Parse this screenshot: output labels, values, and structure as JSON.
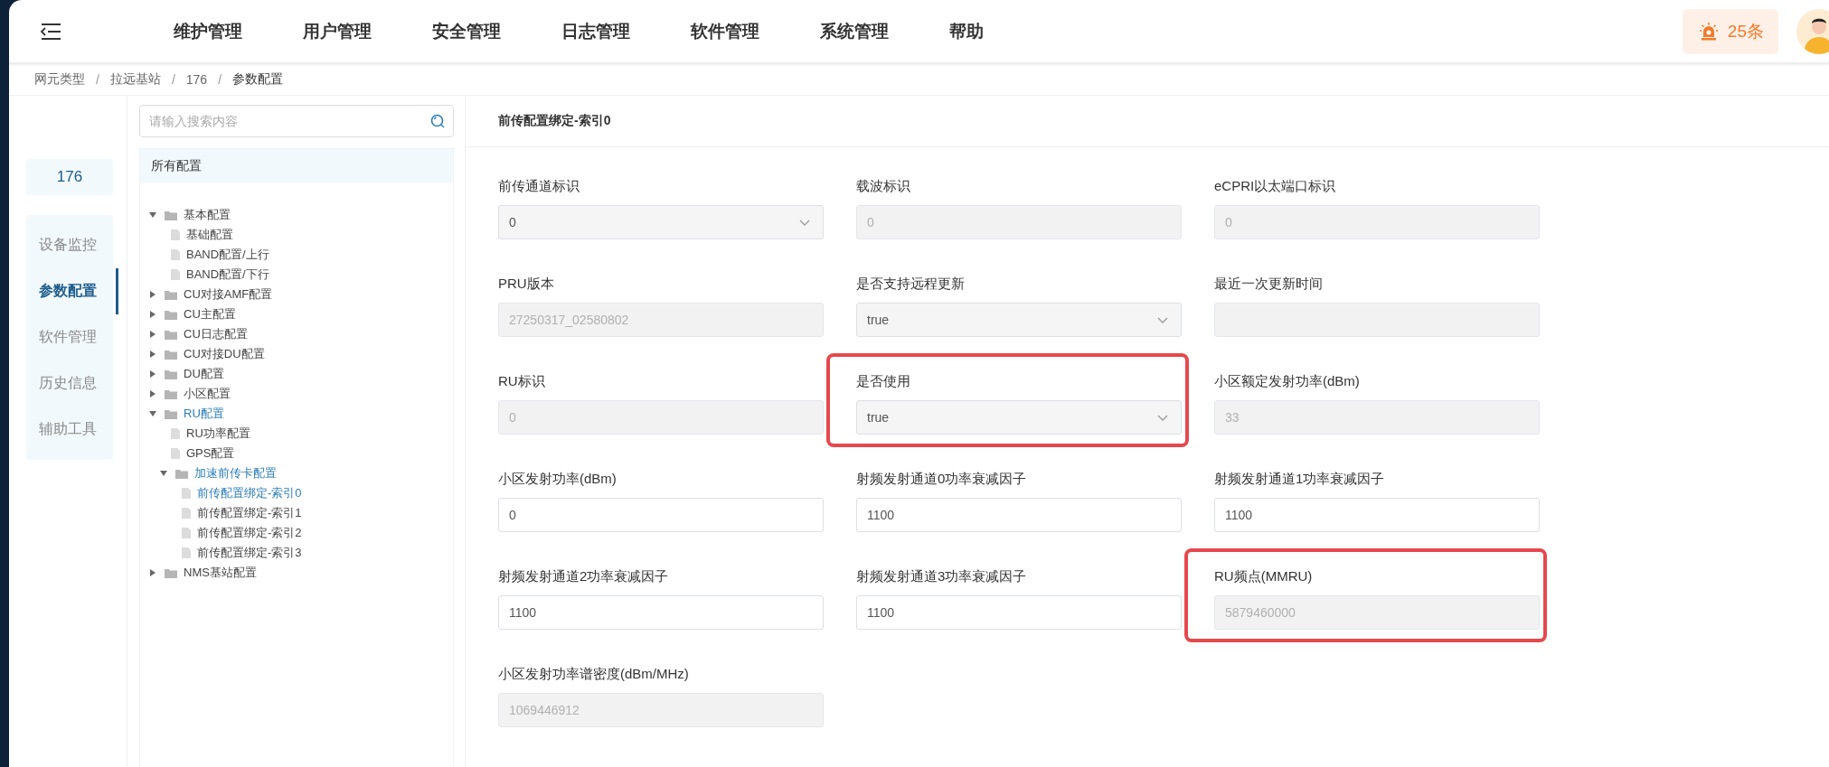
{
  "header": {
    "menu": [
      {
        "label": "维护管理"
      },
      {
        "label": "用户管理"
      },
      {
        "label": "安全管理"
      },
      {
        "label": "日志管理"
      },
      {
        "label": "软件管理"
      },
      {
        "label": "系统管理"
      },
      {
        "label": "帮助"
      }
    ],
    "alarm_count": "25条"
  },
  "breadcrumb": {
    "separator": "/",
    "items": [
      "网元类型",
      "拉远基站",
      "176",
      "参数配置"
    ]
  },
  "device": "176",
  "nav": [
    {
      "label": "设备监控",
      "selected": false
    },
    {
      "label": "参数配置",
      "selected": true
    },
    {
      "label": "软件管理",
      "selected": false
    },
    {
      "label": "历史信息",
      "selected": false
    },
    {
      "label": "辅助工具",
      "selected": false
    }
  ],
  "search": {
    "placeholder": "请输入搜索内容"
  },
  "tree": {
    "title": "所有配置",
    "items": [
      {
        "kind": "folder",
        "label": "基本配置",
        "expanded": true,
        "selected": false,
        "children": [
          {
            "kind": "file",
            "label": "基础配置",
            "selected": false
          },
          {
            "kind": "file",
            "label": "BAND配置/上行",
            "selected": false
          },
          {
            "kind": "file",
            "label": "BAND配置/下行",
            "selected": false
          }
        ]
      },
      {
        "kind": "folder",
        "label": "CU对接AMF配置",
        "expanded": false,
        "selected": false
      },
      {
        "kind": "folder",
        "label": "CU主配置",
        "expanded": false,
        "selected": false
      },
      {
        "kind": "folder",
        "label": "CU日志配置",
        "expanded": false,
        "selected": false
      },
      {
        "kind": "folder",
        "label": "CU对接DU配置",
        "expanded": false,
        "selected": false
      },
      {
        "kind": "folder",
        "label": "DU配置",
        "expanded": false,
        "selected": false
      },
      {
        "kind": "folder",
        "label": "小区配置",
        "expanded": false,
        "selected": false
      },
      {
        "kind": "folder",
        "label": "RU配置",
        "expanded": true,
        "selected": true,
        "children": [
          {
            "kind": "file",
            "label": "RU功率配置",
            "selected": false
          },
          {
            "kind": "file",
            "label": "GPS配置",
            "selected": false
          },
          {
            "kind": "folder",
            "label": "加速前传卡配置",
            "expanded": true,
            "selected": true,
            "children": [
              {
                "kind": "file",
                "label": "前传配置绑定-索引0",
                "selected": true
              },
              {
                "kind": "file",
                "label": "前传配置绑定-索引1",
                "selected": false
              },
              {
                "kind": "file",
                "label": "前传配置绑定-索引2",
                "selected": false
              },
              {
                "kind": "file",
                "label": "前传配置绑定-索引3",
                "selected": false
              }
            ]
          }
        ]
      },
      {
        "kind": "folder",
        "label": "NMS基站配置",
        "expanded": false,
        "selected": false
      }
    ]
  },
  "form": {
    "title": "前传配置绑定-索引0",
    "fields": [
      {
        "label": "前传通道标识",
        "kind": "select",
        "value": "0",
        "disabled": false,
        "highlighted": false
      },
      {
        "label": "载波标识",
        "kind": "input",
        "value": "0",
        "disabled": true,
        "highlighted": false
      },
      {
        "label": "eCPRI以太端口标识",
        "kind": "input",
        "value": "0",
        "disabled": true,
        "highlighted": false
      },
      {
        "label": "PRU版本",
        "kind": "input",
        "value": "27250317_02580802",
        "disabled": true,
        "highlighted": false
      },
      {
        "label": "是否支持远程更新",
        "kind": "select",
        "value": "true",
        "disabled": false,
        "highlighted": false
      },
      {
        "label": "最近一次更新时间",
        "kind": "input",
        "disabled": true,
        "highlighted": false
      },
      {
        "label": "RU标识",
        "kind": "input",
        "value": "0",
        "disabled": true,
        "highlighted": false
      },
      {
        "label": "是否使用",
        "kind": "select",
        "value": "true",
        "disabled": false,
        "highlighted": true
      },
      {
        "label": "小区额定发射功率(dBm)",
        "kind": "input",
        "value": "33",
        "disabled": true,
        "highlighted": false
      },
      {
        "label": "小区发射功率(dBm)",
        "kind": "input",
        "value": "0",
        "disabled": false,
        "highlighted": false
      },
      {
        "label": "射频发射通道0功率衰减因子",
        "kind": "input",
        "value": "1100",
        "disabled": false,
        "highlighted": false
      },
      {
        "label": "射频发射通道1功率衰减因子",
        "kind": "input",
        "value": "1100",
        "disabled": false,
        "highlighted": false
      },
      {
        "label": "射频发射通道2功率衰减因子",
        "kind": "input",
        "value": "1100",
        "disabled": false,
        "highlighted": false
      },
      {
        "label": "射频发射通道3功率衰减因子",
        "kind": "input",
        "value": "1100",
        "disabled": false,
        "highlighted": false
      },
      {
        "label": "RU频点(MMRU)",
        "kind": "input",
        "value": "5879460000",
        "disabled": true,
        "highlighted": true
      },
      {
        "label": "小区发射功率谱密度(dBm/MHz)",
        "kind": "input",
        "value": "1069446912",
        "disabled": true,
        "highlighted": false
      }
    ]
  }
}
